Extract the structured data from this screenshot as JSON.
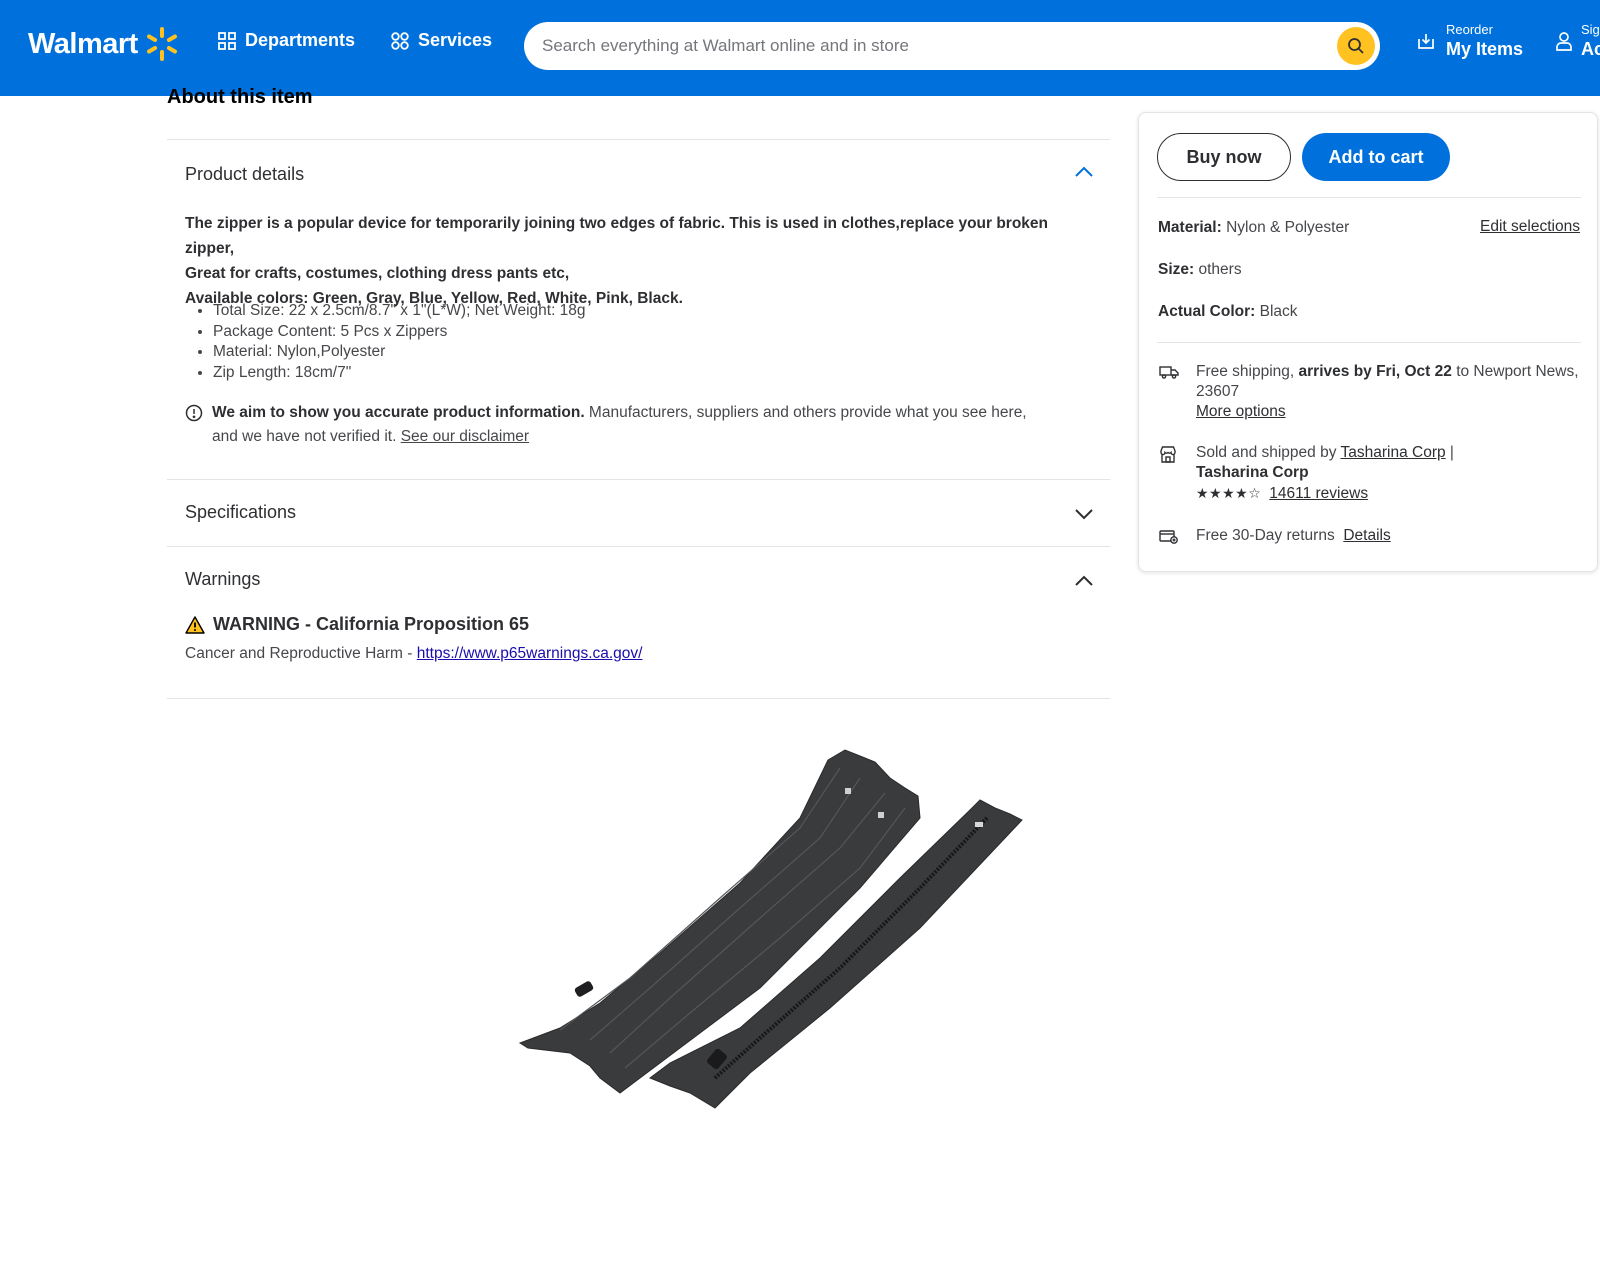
{
  "header": {
    "logo_text": "Walmart",
    "departments_label": "Departments",
    "services_label": "Services",
    "search_placeholder": "Search everything at Walmart online and in store",
    "reorder_small": "Reorder",
    "reorder_big": "My Items",
    "account_small": "Sig",
    "account_big": "Ac",
    "brand_color": "#0071dc",
    "spark_color": "#ffc220"
  },
  "main": {
    "about_title": "About this item",
    "product_details": {
      "heading": "Product details",
      "desc_line1": "The zipper is a popular device for temporarily joining two edges of fabric. This is used in clothes,replace your broken zipper,",
      "desc_line2": "Great for crafts, costumes, clothing dress pants etc,",
      "desc_line3": "Available colors: Green, Gray, Blue, Yellow, Red, White, Pink, Black.",
      "bullets": [
        "Total Size: 22 x 2.5cm/8.7\" x 1\"(L*W); Net Weight: 18g",
        "Package Content: 5 Pcs x Zippers",
        "Material: Nylon,Polyester",
        "Zip Length: 18cm/7\""
      ],
      "disclaimer_bold": "We aim to show you accurate product information.",
      "disclaimer_text": " Manufacturers, suppliers and others provide what you see here, and we have not verified it. ",
      "disclaimer_link": "See our disclaimer"
    },
    "specifications": {
      "heading": "Specifications"
    },
    "warnings": {
      "heading": "Warnings",
      "title": "WARNING - California Proposition 65",
      "text": "Cancer and Reproductive Harm - ",
      "link": "https://www.p65warnings.ca.gov/"
    }
  },
  "panel": {
    "buy_now": "Buy now",
    "add_to_cart": "Add to cart",
    "material_label": "Material:",
    "material_value": "Nylon & Polyester",
    "edit_selections": "Edit selections",
    "size_label": "Size:",
    "size_value": "others",
    "color_label": "Actual Color:",
    "color_value": "Black",
    "shipping_prefix": "Free shipping, ",
    "shipping_bold": "arrives by Fri, Oct 22",
    "shipping_suffix": " to Newport News, 23607",
    "more_options": "More options",
    "sold_prefix": "Sold and shipped by ",
    "seller_link": "Tasharina Corp",
    "seller_sep": " | ",
    "seller_bold": "Tasharina Corp",
    "stars": "★★★★☆",
    "rating": 4,
    "reviews": "14611 reviews",
    "returns_text": "Free 30-Day returns",
    "returns_link": "Details"
  }
}
